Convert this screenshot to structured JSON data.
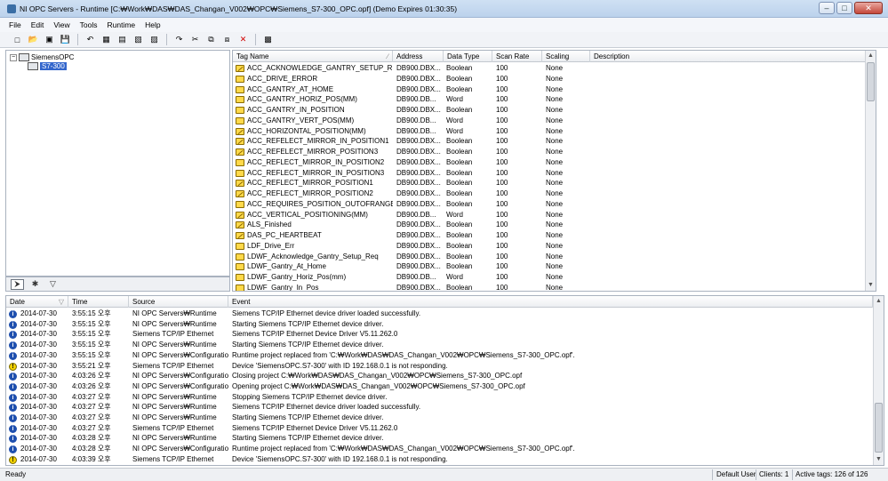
{
  "window": {
    "title": "NI OPC Servers - Runtime [C:₩Work₩DAS₩DAS_Changan_V002₩OPC₩Siemens_S7-300_OPC.opf] (Demo Expires 01:30:35)",
    "minimize_glyph": "–",
    "maximize_glyph": "□",
    "close_glyph": "✕"
  },
  "menu": [
    "File",
    "Edit",
    "View",
    "Tools",
    "Runtime",
    "Help"
  ],
  "toolbar_glyphs": [
    "□",
    "📂",
    "▣",
    "💾",
    "↶",
    "▦",
    "▤",
    "▧",
    "▨",
    "↷",
    "✂",
    "⧉",
    "⧈",
    "✕",
    "▩"
  ],
  "tree": {
    "root_expander": "−",
    "root": "SiemensOPC",
    "channel": "S7-300"
  },
  "tree_tab_glyphs": [
    "⮞",
    "✱",
    "▽"
  ],
  "tag_table": {
    "columns": [
      "Tag Name",
      "Address",
      "Data Type",
      "Scan Rate",
      "Scaling",
      "Description"
    ],
    "sort_glyph": "∕",
    "rows": [
      {
        "icon": "analog",
        "name": "ACC_ACKNOWLEDGE_GANTRY_SETUP_REQ",
        "address": "DB900.DBX...",
        "type": "Boolean",
        "rate": "100",
        "scaling": "None"
      },
      {
        "icon": "discrete",
        "name": "ACC_DRIVE_ERROR",
        "address": "DB900.DBX...",
        "type": "Boolean",
        "rate": "100",
        "scaling": "None"
      },
      {
        "icon": "discrete",
        "name": "ACC_GANTRY_AT_HOME",
        "address": "DB900.DBX...",
        "type": "Boolean",
        "rate": "100",
        "scaling": "None"
      },
      {
        "icon": "discrete",
        "name": "ACC_GANTRY_HORIZ_POS(MM)",
        "address": "DB900.DB...",
        "type": "Word",
        "rate": "100",
        "scaling": "None"
      },
      {
        "icon": "discrete",
        "name": "ACC_GANTRY_IN_POSITION",
        "address": "DB900.DBX...",
        "type": "Boolean",
        "rate": "100",
        "scaling": "None"
      },
      {
        "icon": "discrete",
        "name": "ACC_GANTRY_VERT_POS(MM)",
        "address": "DB900.DB...",
        "type": "Word",
        "rate": "100",
        "scaling": "None"
      },
      {
        "icon": "analog",
        "name": "ACC_HORIZONTAL_POSITION(MM)",
        "address": "DB900.DB...",
        "type": "Word",
        "rate": "100",
        "scaling": "None"
      },
      {
        "icon": "analog",
        "name": "ACC_REFELECT_MIRROR_IN_POSITION1",
        "address": "DB900.DBX...",
        "type": "Boolean",
        "rate": "100",
        "scaling": "None"
      },
      {
        "icon": "analog",
        "name": "ACC_REFELECT_MIRROR_POSITION3",
        "address": "DB900.DBX...",
        "type": "Boolean",
        "rate": "100",
        "scaling": "None"
      },
      {
        "icon": "discrete",
        "name": "ACC_REFLECT_MIRROR_IN_POSITION2",
        "address": "DB900.DBX...",
        "type": "Boolean",
        "rate": "100",
        "scaling": "None"
      },
      {
        "icon": "discrete",
        "name": "ACC_REFLECT_MIRROR_IN_POSITION3",
        "address": "DB900.DBX...",
        "type": "Boolean",
        "rate": "100",
        "scaling": "None"
      },
      {
        "icon": "analog",
        "name": "ACC_REFLECT_MIRROR_POSITION1",
        "address": "DB900.DBX...",
        "type": "Boolean",
        "rate": "100",
        "scaling": "None"
      },
      {
        "icon": "analog",
        "name": "ACC_REFLECT_MIRROR_POSITION2",
        "address": "DB900.DBX...",
        "type": "Boolean",
        "rate": "100",
        "scaling": "None"
      },
      {
        "icon": "discrete",
        "name": "ACC_REQUIRES_POSITION_OUTOFRANGE",
        "address": "DB900.DBX...",
        "type": "Boolean",
        "rate": "100",
        "scaling": "None"
      },
      {
        "icon": "analog",
        "name": "ACC_VERTICAL_POSITIONING(MM)",
        "address": "DB900.DB...",
        "type": "Word",
        "rate": "100",
        "scaling": "None"
      },
      {
        "icon": "analog",
        "name": "ALS_Finished",
        "address": "DB900.DBX...",
        "type": "Boolean",
        "rate": "100",
        "scaling": "None"
      },
      {
        "icon": "analog",
        "name": "DAS_PC_HEARTBEAT",
        "address": "DB900.DBX...",
        "type": "Boolean",
        "rate": "100",
        "scaling": "None"
      },
      {
        "icon": "discrete",
        "name": "LDF_Drive_Err",
        "address": "DB900.DBX...",
        "type": "Boolean",
        "rate": "100",
        "scaling": "None"
      },
      {
        "icon": "discrete",
        "name": "LDWF_Acknowledge_Gantry_Setup_Req",
        "address": "DB900.DBX...",
        "type": "Boolean",
        "rate": "100",
        "scaling": "None"
      },
      {
        "icon": "discrete",
        "name": "LDWF_Gantry_At_Home",
        "address": "DB900.DBX...",
        "type": "Boolean",
        "rate": "100",
        "scaling": "None"
      },
      {
        "icon": "discrete",
        "name": "LDWF_Gantry_Horiz_Pos(mm)",
        "address": "DB900.DB...",
        "type": "Word",
        "rate": "100",
        "scaling": "None"
      },
      {
        "icon": "discrete",
        "name": "LDWF_Gantry_In_Pos",
        "address": "DB900.DBX...",
        "type": "Boolean",
        "rate": "100",
        "scaling": "None"
      }
    ]
  },
  "log": {
    "columns": [
      "Date",
      "Time",
      "Source",
      "Event"
    ],
    "sort_glyph": "▽",
    "rows": [
      {
        "sev": "info",
        "date": "2014-07-30",
        "time": "3:55:15 오후",
        "source": "NI OPC Servers₩Runtime",
        "event": "Siemens TCP/IP Ethernet device driver loaded successfully."
      },
      {
        "sev": "info",
        "date": "2014-07-30",
        "time": "3:55:15 오후",
        "source": "NI OPC Servers₩Runtime",
        "event": "Starting Siemens TCP/IP Ethernet device driver."
      },
      {
        "sev": "info",
        "date": "2014-07-30",
        "time": "3:55:15 오후",
        "source": "Siemens TCP/IP Ethernet",
        "event": "Siemens TCP/IP Ethernet Device Driver V5.11.262.0"
      },
      {
        "sev": "info",
        "date": "2014-07-30",
        "time": "3:55:15 오후",
        "source": "NI OPC Servers₩Runtime",
        "event": "Starting Siemens TCP/IP Ethernet device driver."
      },
      {
        "sev": "info",
        "date": "2014-07-30",
        "time": "3:55:15 오후",
        "source": "NI OPC Servers₩Configuration",
        "event": "Runtime project replaced from 'C:₩Work₩DAS₩DAS_Changan_V002₩OPC₩Siemens_S7-300_OPC.opf'."
      },
      {
        "sev": "warn",
        "date": "2014-07-30",
        "time": "3:55:21 오후",
        "source": "Siemens TCP/IP Ethernet",
        "event": "Device 'SiemensOPC.S7-300' with ID 192.168.0.1 is not responding."
      },
      {
        "sev": "info",
        "date": "2014-07-30",
        "time": "4:03:26 오후",
        "source": "NI OPC Servers₩Configuration",
        "event": "Closing project C:₩Work₩DAS₩DAS_Changan_V002₩OPC₩Siemens_S7-300_OPC.opf"
      },
      {
        "sev": "info",
        "date": "2014-07-30",
        "time": "4:03:26 오후",
        "source": "NI OPC Servers₩Configuration",
        "event": "Opening project C:₩Work₩DAS₩DAS_Changan_V002₩OPC₩Siemens_S7-300_OPC.opf"
      },
      {
        "sev": "info",
        "date": "2014-07-30",
        "time": "4:03:27 오후",
        "source": "NI OPC Servers₩Runtime",
        "event": "Stopping Siemens TCP/IP Ethernet device driver."
      },
      {
        "sev": "info",
        "date": "2014-07-30",
        "time": "4:03:27 오후",
        "source": "NI OPC Servers₩Runtime",
        "event": "Siemens TCP/IP Ethernet device driver loaded successfully."
      },
      {
        "sev": "info",
        "date": "2014-07-30",
        "time": "4:03:27 오후",
        "source": "NI OPC Servers₩Runtime",
        "event": "Starting Siemens TCP/IP Ethernet device driver."
      },
      {
        "sev": "info",
        "date": "2014-07-30",
        "time": "4:03:27 오후",
        "source": "Siemens TCP/IP Ethernet",
        "event": "Siemens TCP/IP Ethernet Device Driver V5.11.262.0"
      },
      {
        "sev": "info",
        "date": "2014-07-30",
        "time": "4:03:28 오후",
        "source": "NI OPC Servers₩Runtime",
        "event": "Starting Siemens TCP/IP Ethernet device driver."
      },
      {
        "sev": "info",
        "date": "2014-07-30",
        "time": "4:03:28 오후",
        "source": "NI OPC Servers₩Configuration",
        "event": "Runtime project replaced from 'C:₩Work₩DAS₩DAS_Changan_V002₩OPC₩Siemens_S7-300_OPC.opf'."
      },
      {
        "sev": "warn",
        "date": "2014-07-30",
        "time": "4:03:39 오후",
        "source": "Siemens TCP/IP Ethernet",
        "event": "Device 'SiemensOPC.S7-300' with ID 192.168.0.1 is not responding."
      }
    ]
  },
  "status": {
    "left": "Ready",
    "user": "Default User",
    "clients": "Clients: 1",
    "tags": "Active tags: 126 of 126"
  },
  "scroll_glyphs": {
    "up": "▲",
    "down": "▼"
  },
  "severity_glyphs": {
    "info": "i",
    "warn": "!"
  },
  "colors": {
    "selection": "#3366cc",
    "info_icon": "#1e4fae",
    "warn_icon": "#f2d100",
    "tag_icon": "#ffd94a"
  }
}
